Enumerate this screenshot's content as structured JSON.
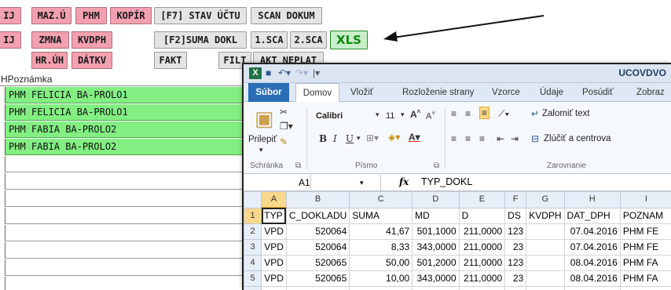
{
  "app": {
    "toolbar_row1": {
      "b1": "IJ",
      "b2": "MAZ.Ú",
      "b3": "PHM",
      "b4": "KOPÍR",
      "b5": "[F7] STAV ÚČTU",
      "b6": "SCAN DOKUM"
    },
    "toolbar_row2": {
      "b1": "IJ",
      "b2": "ZMNA",
      "b3": "KVDPH",
      "b4": "[F2]SUMA DOKL",
      "b5": "1.SCA",
      "b6": "2.SCA",
      "b7": "XLS"
    },
    "toolbar_row3": {
      "b1": "HR.ÚH",
      "b2": "DÁTKV",
      "b3": "FAKT",
      "b4": "FILT",
      "b5": "AKT NEPLAT"
    },
    "grid": {
      "header": "HPoznámka",
      "rows": [
        "PHM FELICIA BA-PROLO1",
        "PHM FELICIA BA-PROLO1",
        "PHM FABIA BA-PROLO2",
        "PHM FABIA BA-PROLO2"
      ]
    }
  },
  "excel": {
    "window_title": "UCOVDVO",
    "logo": "X",
    "tabs": {
      "file": "Súbor",
      "home": "Domov",
      "insert": "Vložiť",
      "layout": "Rozloženie strany",
      "formulas": "Vzorce",
      "data": "Údaje",
      "review": "Posúdiť",
      "view": "Zobraz"
    },
    "ribbon": {
      "paste": "Prilepiť",
      "font_name": "Calibri",
      "font_size": "11",
      "wrap_text": "Zalomiť text",
      "merge_center": "Zlúčiť a centrova",
      "group_clipboard": "Schránka",
      "group_font": "Písmo",
      "group_alignment": "Zarovnanie"
    },
    "name_box": "A1",
    "fx": "fx",
    "formula": "TYP_DOKL",
    "columns": [
      "A",
      "B",
      "C",
      "D",
      "E",
      "F",
      "G",
      "H",
      "I"
    ],
    "rows": [
      [
        "1",
        "TYP",
        "C_DOKLADU",
        "SUMA",
        "MD",
        "D",
        "DS",
        "KVDPH",
        "DAT_DPH",
        "POZNAM"
      ],
      [
        "2",
        "VPD",
        "520064",
        "41,67",
        "501,1000",
        "211,0000",
        "123",
        "",
        "07.04.2016",
        "PHM FE"
      ],
      [
        "3",
        "VPD",
        "520064",
        "8,33",
        "343,0000",
        "211,0000",
        "23",
        "",
        "07.04.2016",
        "PHM FE"
      ],
      [
        "4",
        "VPD",
        "520065",
        "50,00",
        "501,2000",
        "211,0000",
        "123",
        "",
        "08.04.2016",
        "PHM FA"
      ],
      [
        "5",
        "VPD",
        "520065",
        "10,00",
        "343,0000",
        "211,0000",
        "23",
        "",
        "08.04.2016",
        "PHM FA"
      ],
      [
        "6",
        "",
        "",
        "",
        "",
        "",
        "",
        "",
        "",
        ""
      ]
    ]
  }
}
